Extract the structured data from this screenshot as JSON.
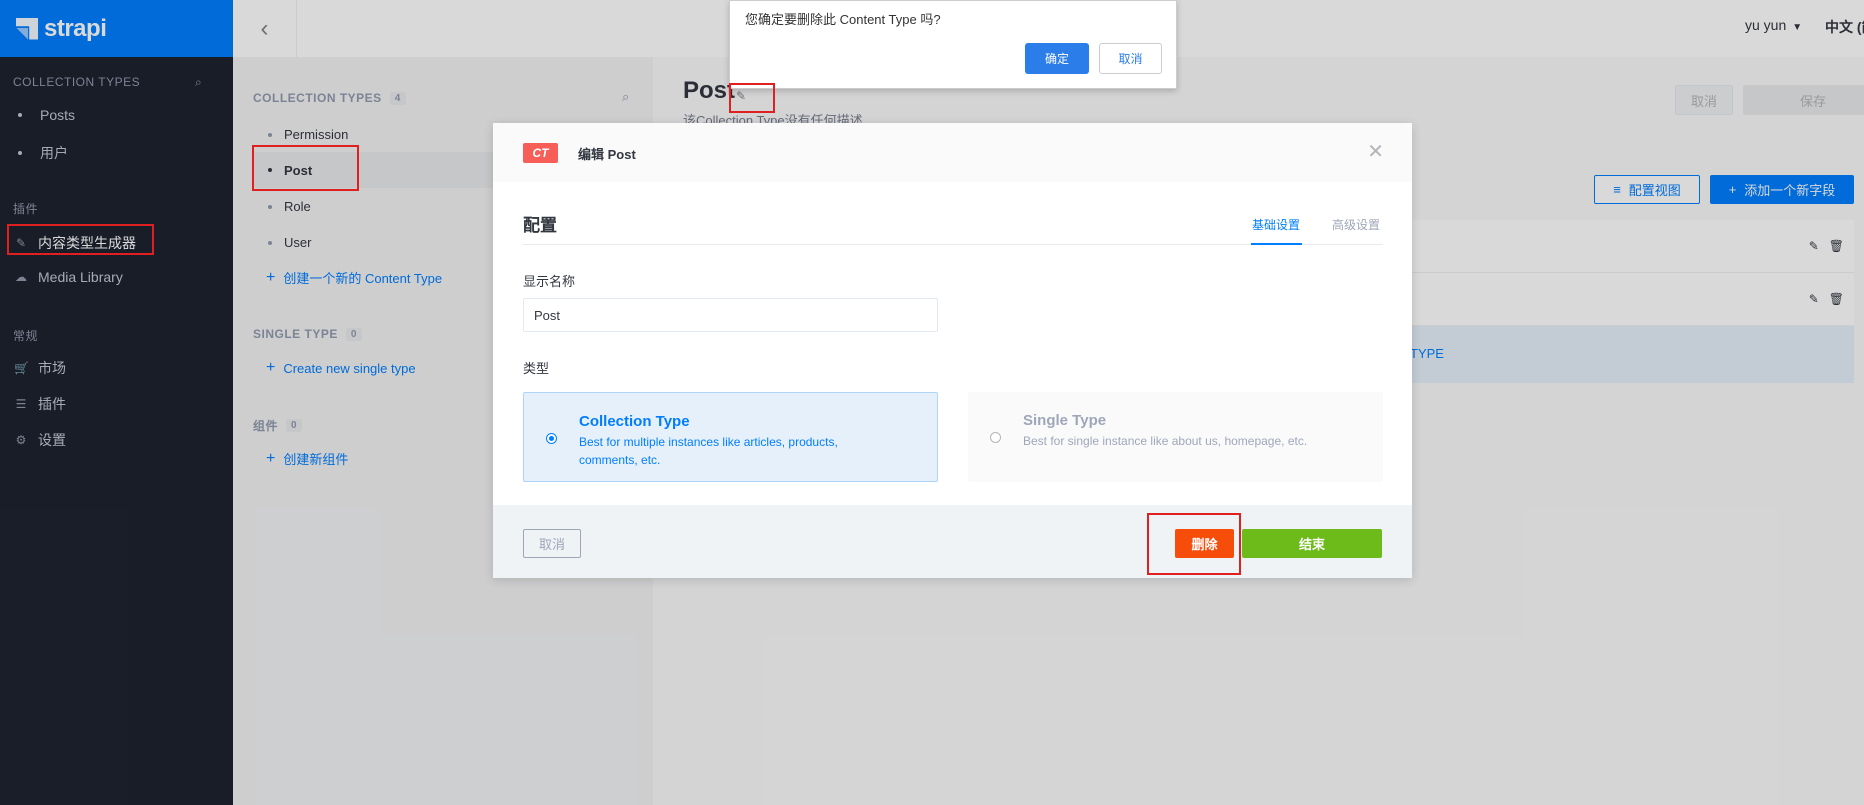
{
  "brand": {
    "name": "strapi"
  },
  "leftnav": {
    "collection_section": "COLLECTION TYPES",
    "collection_items": [
      "Posts",
      "用户"
    ],
    "plugins_section": "插件",
    "plugin_items": [
      {
        "label": "内容类型生成器",
        "icon": "brush-icon"
      },
      {
        "label": "Media Library",
        "icon": "cloud-upload-icon"
      }
    ],
    "general_section": "常规",
    "general_items": [
      {
        "label": "市场",
        "icon": "basket-icon"
      },
      {
        "label": "插件",
        "icon": "list-icon"
      },
      {
        "label": "设置",
        "icon": "gear-icon"
      }
    ]
  },
  "topbar": {
    "user": "yu yun",
    "lang": "中文 (简"
  },
  "ctb": {
    "collection_header": "COLLECTION TYPES",
    "collection_count": "4",
    "collection_items": [
      "Permission",
      "Post",
      "Role",
      "User"
    ],
    "create_collection": "创建一个新的 Content Type",
    "single_header": "SINGLE TYPE",
    "single_count": "0",
    "create_single": "Create new single type",
    "components_header": "组件",
    "components_count": "0",
    "create_component": "创建新组件"
  },
  "main": {
    "title": "Post",
    "subtitle": "该Collection Type没有任何描述",
    "cancel": "取消",
    "save": "保存",
    "config_view": "配置视图",
    "add_field": "添加一个新字段",
    "add_row_text": "TYPE"
  },
  "modal": {
    "badge": "CT",
    "title": "编辑 Post",
    "section": "配置",
    "tab_basic": "基础设置",
    "tab_advanced": "高级设置",
    "display_name_label": "显示名称",
    "display_name_value": "Post",
    "type_label": "类型",
    "collection_type_title": "Collection Type",
    "collection_type_desc": "Best for multiple instances like articles, products, comments, etc.",
    "single_type_title": "Single Type",
    "single_type_desc": "Best for single instance like about us, homepage, etc.",
    "cancel": "取消",
    "delete": "删除",
    "finish": "结束"
  },
  "confirm": {
    "message": "您确定要删除此 Content Type 吗?",
    "ok": "确定",
    "cancel": "取消"
  },
  "colors": {
    "primary": "#007eff",
    "danger": "#f64d0a",
    "success": "#6dbb1a",
    "nav_bg": "#1d2330"
  }
}
